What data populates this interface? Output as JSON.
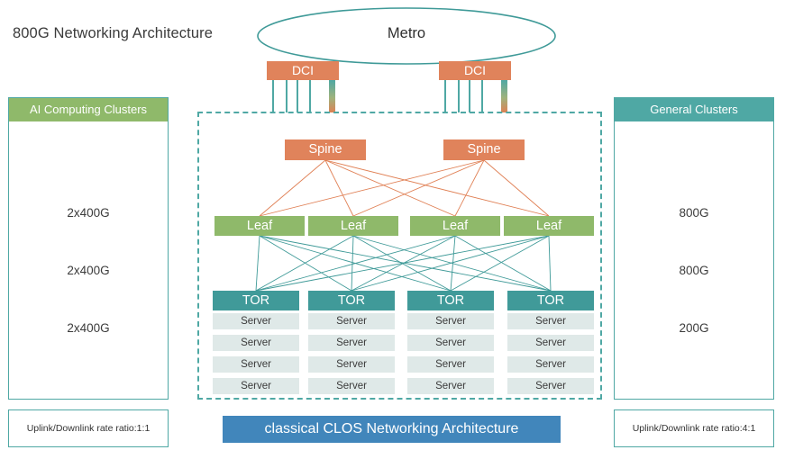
{
  "page": {
    "title": "800G Networking Architecture",
    "background": "#ffffff"
  },
  "metro": {
    "label": "Metro",
    "shape": "ellipse",
    "stroke": "#3f9a98"
  },
  "dci": {
    "left_label": "DCI",
    "right_label": "DCI",
    "color": "#e0835b"
  },
  "clusters": {
    "ai": {
      "header": "AI Computing Clusters",
      "header_color": "#8fb96a",
      "border_color": "#4fa8a4",
      "rates": [
        "2x400G",
        "2x400G",
        "2x400G"
      ],
      "ratio_note": "Uplink/Downlink rate ratio:1:1"
    },
    "general": {
      "header": "General Clusters",
      "header_color": "#4fa8a4",
      "border_color": "#4fa8a4",
      "rates": [
        "800G",
        "800G",
        "200G"
      ],
      "ratio_note": "Uplink/Downlink rate ratio:4:1"
    }
  },
  "fabric": {
    "container_label": "classical CLOS Networking Architecture",
    "container_border": "#4fa8a4",
    "banner_color": "#4186bb",
    "spines": [
      {
        "label": "Spine"
      },
      {
        "label": "Spine"
      }
    ],
    "leaves": [
      {
        "label": "Leaf"
      },
      {
        "label": "Leaf"
      },
      {
        "label": "Leaf"
      },
      {
        "label": "Leaf"
      }
    ],
    "racks": [
      {
        "tor": "TOR",
        "servers": [
          "Server",
          "Server",
          "Server",
          "Server"
        ]
      },
      {
        "tor": "TOR",
        "servers": [
          "Server",
          "Server",
          "Server",
          "Server"
        ]
      },
      {
        "tor": "TOR",
        "servers": [
          "Server",
          "Server",
          "Server",
          "Server"
        ]
      },
      {
        "tor": "TOR",
        "servers": [
          "Server",
          "Server",
          "Server",
          "Server"
        ]
      }
    ],
    "colors": {
      "spine": "#e0835b",
      "leaf": "#8fb96a",
      "tor": "#409a99",
      "server": "#dfe9e8",
      "spine_link": "#e08055",
      "leaf_link": "#3f9a98"
    }
  }
}
